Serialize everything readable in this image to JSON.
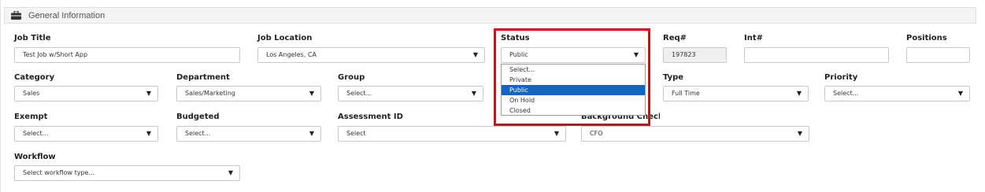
{
  "section": {
    "title": "General Information",
    "icon": "briefcase-icon"
  },
  "fields": {
    "job_title": {
      "label": "Job Title",
      "value": "Test Job w/Short App"
    },
    "job_location": {
      "label": "Job Location",
      "value": "Los Angeles, CA"
    },
    "status": {
      "label": "Status",
      "value": "Public"
    },
    "req": {
      "label": "Req#",
      "value": "197823"
    },
    "int": {
      "label": "Int#",
      "value": ""
    },
    "positions": {
      "label": "Positions",
      "value": ""
    },
    "category": {
      "label": "Category",
      "value": "Sales"
    },
    "department": {
      "label": "Department",
      "value": "Sales/Marketing"
    },
    "group": {
      "label": "Group",
      "value": "Select..."
    },
    "type": {
      "label": "Type",
      "value": "Full Time"
    },
    "priority": {
      "label": "Priority",
      "value": "Select..."
    },
    "exempt": {
      "label": "Exempt",
      "value": "Select..."
    },
    "budgeted": {
      "label": "Budgeted",
      "value": "Select..."
    },
    "assessment_id": {
      "label": "Assessment ID",
      "value": "Select"
    },
    "background_check": {
      "label": "Background Check",
      "value": "CFO"
    },
    "workflow": {
      "label": "Workflow",
      "value": "Select workflow type..."
    }
  },
  "status_dropdown": {
    "options": [
      "Select...",
      "Private",
      "Public",
      "On Hold",
      "Closed"
    ],
    "selected": "Public"
  },
  "caret": "▼",
  "colors": {
    "highlight": "#e3001b",
    "selected_option": "#1565c0"
  }
}
